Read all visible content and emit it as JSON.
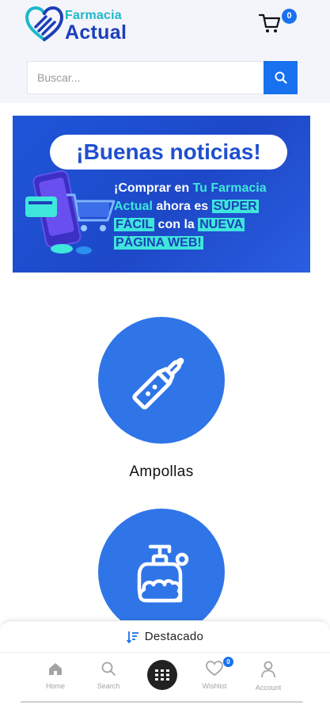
{
  "header": {
    "logo_top": "Farmacia",
    "logo_bottom": "Actual",
    "cart_count": "0"
  },
  "search": {
    "placeholder": "Buscar..."
  },
  "banner": {
    "headline": "¡Buenas noticias!",
    "line1_a": "¡Comprar en ",
    "line1_b": "Tu Farmacia",
    "line2_a": "Actual",
    "line2_b": " ahora es ",
    "line2_c": "SÚPER",
    "line3_a": "FÁCIL",
    "line3_b": " con la ",
    "line3_c": "NUEVA",
    "line4": "PÁGINA WEB!"
  },
  "categories": [
    {
      "label": "Ampollas",
      "icon": "ampoule-icon"
    },
    {
      "label": "",
      "icon": "soap-dispenser-icon"
    }
  ],
  "featured": {
    "label": "Destacado"
  },
  "bottom_nav": {
    "items": [
      {
        "label": "Home",
        "icon": "home-icon"
      },
      {
        "label": "Search",
        "icon": "search-icon"
      },
      {
        "label": "",
        "icon": "grid-menu-icon"
      },
      {
        "label": "Wishlist",
        "icon": "heart-icon"
      },
      {
        "label": "Account",
        "icon": "user-icon"
      }
    ],
    "wishlist_count": "0"
  },
  "colors": {
    "primary": "#1871ee",
    "category_circle": "#2f75e8",
    "logo_teal": "#1cb8c9",
    "logo_navy": "#1c3fb8",
    "banner_highlight": "#3fe6dc"
  }
}
